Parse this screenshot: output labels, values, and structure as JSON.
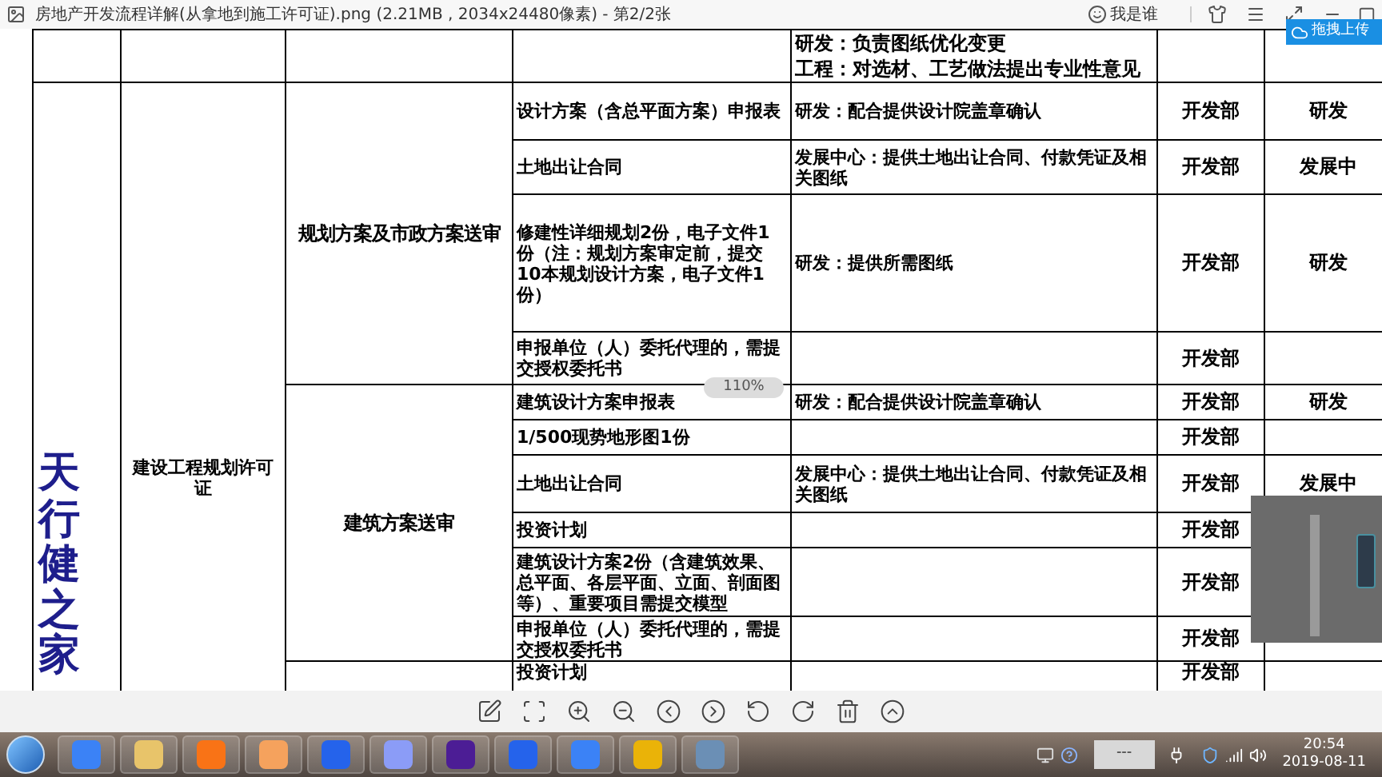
{
  "window": {
    "title": "房地产开发流程详解(从拿地到施工许可证).png (2.21MB , 2034x24480像素) - 第2/2张",
    "user": "我是谁",
    "upload_button": "拖拽上传"
  },
  "document": {
    "top_row": {
      "notes": [
        "研发：负责图纸优化变更",
        "工程：对选材、工艺做法提出专业性意见"
      ]
    },
    "brand": "天行健之家",
    "permit": "建设工程规划许可证",
    "groups": [
      {
        "stage": "规划方案及市政方案送审",
        "rows": [
          {
            "item": "设计方案（含总平面方案）申报表",
            "support": "研发：配合提供设计院盖章确认",
            "lead": "开发部",
            "partner": "研发"
          },
          {
            "item": "土地出让合同",
            "support": "发展中心：提供土地出让合同、付款凭证及相关图纸",
            "lead": "开发部",
            "partner": "发展中"
          },
          {
            "item": "修建性详细规划2份，电子文件1份（注：规划方案审定前，提交10本规划设计方案，电子文件1份）",
            "support": "研发：提供所需图纸",
            "lead": "开发部",
            "partner": "研发"
          },
          {
            "item": "申报单位（人）委托代理的，需提交授权委托书",
            "lead": "开发部"
          }
        ]
      },
      {
        "stage": "建筑方案送审",
        "rows": [
          {
            "item": "建筑设计方案申报表",
            "support": "研发：配合提供设计院盖章确认",
            "lead": "开发部",
            "partner": "研发"
          },
          {
            "item": "1/500现势地形图1份",
            "lead": "开发部"
          },
          {
            "item": "土地出让合同",
            "support": "发展中心：提供土地出让合同、付款凭证及相关图纸",
            "lead": "开发部",
            "partner": "发展中"
          },
          {
            "item": "投资计划",
            "lead": "开发部"
          },
          {
            "item": "建筑设计方案2份（含建筑效果、总平面、各层平面、立面、剖面图等）、重要项目需提交模型",
            "lead": "开发部"
          },
          {
            "item": "申报单位（人）委托代理的，需提交授权委托书",
            "lead": "开发部"
          }
        ]
      },
      {
        "rows": [
          {
            "item": "投资计划",
            "lead": "开发部"
          }
        ]
      }
    ]
  },
  "zoom_badge": "110%",
  "taskbar": {
    "tray_box": "---",
    "time": "20:54",
    "date": "2019-08-11"
  }
}
